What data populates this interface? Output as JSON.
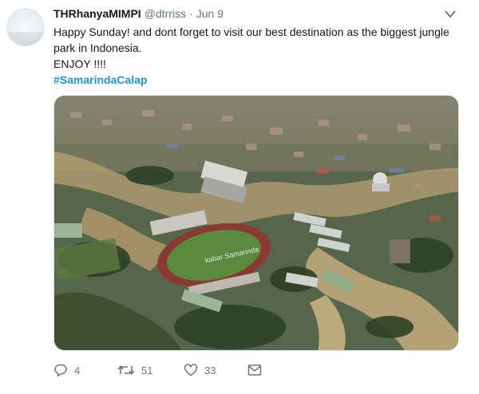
{
  "tweet": {
    "author_name": "THRhanyaMIMPI",
    "handle": "@dtrriss",
    "separator": "·",
    "date": "Jun 9",
    "text_line1": "Happy Sunday! and dont forget to visit our best destination as the biggest jungle",
    "text_line2": "park in Indonesia.",
    "text_line3": "ENJOY !!!!",
    "hashtag": "#SamarindaCalap",
    "watermark": "kabar Samarinda",
    "replies": "4",
    "retweets": "51",
    "likes": "33"
  },
  "colors": {
    "link": "#1b95e0",
    "secondary_text": "#657786",
    "primary_text": "#14171a"
  },
  "icons": {
    "reply": "speech-bubble-icon",
    "retweet": "retweet-arrows-icon",
    "like": "heart-icon",
    "dm": "envelope-icon",
    "menu": "chevron-down-icon"
  }
}
